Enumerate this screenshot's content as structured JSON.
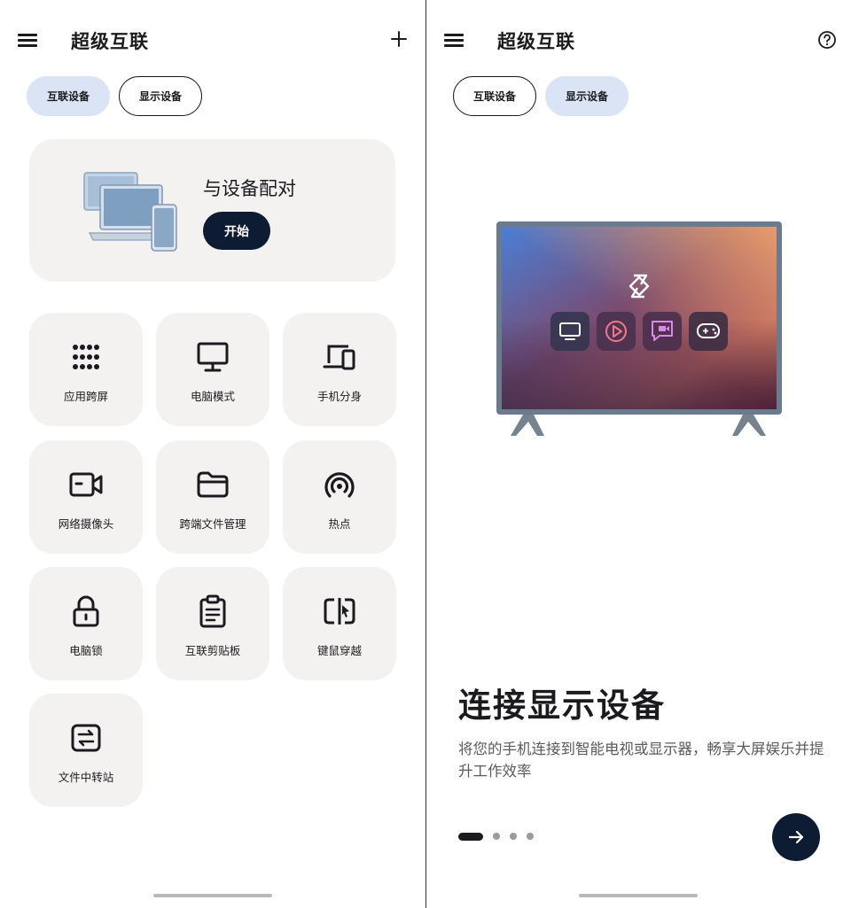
{
  "left": {
    "app_title": "超级互联",
    "icons": {
      "menu": "menu-icon",
      "add": "add-icon"
    },
    "tabs": [
      {
        "label": "互联设备",
        "active": true
      },
      {
        "label": "显示设备",
        "active": false
      }
    ],
    "pair_card": {
      "title": "与设备配对",
      "button_label": "开始",
      "illustration": "laptop-phone-illustration"
    },
    "features": [
      {
        "label": "应用跨屏",
        "icon": "app-grid-icon"
      },
      {
        "label": "电脑模式",
        "icon": "monitor-icon"
      },
      {
        "label": "手机分身",
        "icon": "devices-icon"
      },
      {
        "label": "网络摄像头",
        "icon": "camera-icon"
      },
      {
        "label": "跨端文件管理",
        "icon": "folder-icon"
      },
      {
        "label": "热点",
        "icon": "hotspot-icon"
      },
      {
        "label": "电脑锁",
        "icon": "lock-icon"
      },
      {
        "label": "互联剪贴板",
        "icon": "clipboard-icon"
      },
      {
        "label": "键鼠穿越",
        "icon": "keyboard-mouse-icon"
      },
      {
        "label": "文件中转站",
        "icon": "file-transfer-icon"
      }
    ]
  },
  "right": {
    "app_title": "超级互联",
    "icons": {
      "menu": "menu-icon",
      "help": "help-icon"
    },
    "tabs": [
      {
        "label": "互联设备",
        "active": false
      },
      {
        "label": "显示设备",
        "active": true
      }
    ],
    "headline": "连接显示设备",
    "description": "将您的手机连接到智能电视或显示器，畅享大屏娱乐并提升工作效率",
    "pager": {
      "count": 4,
      "active_index": 0
    },
    "next_icon": "arrow-right-icon"
  },
  "colors": {
    "accent_dark": "#0d1b33",
    "tab_active_bg": "#dbe4f4",
    "tile_bg": "#f3f2f0",
    "text_primary": "#1b1b1f",
    "text_secondary": "#5a5a60"
  }
}
